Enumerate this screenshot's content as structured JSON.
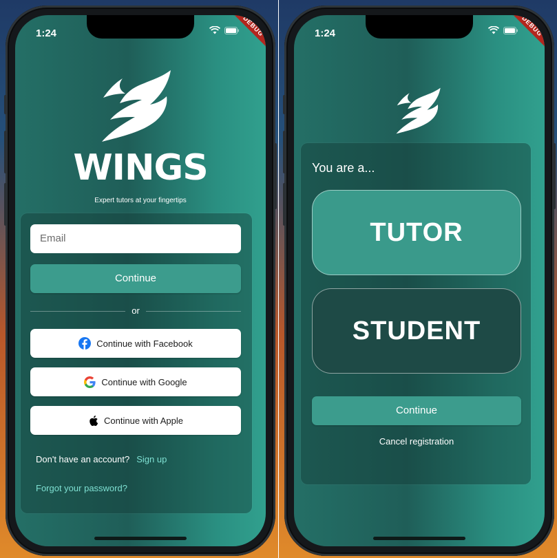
{
  "status_bar": {
    "time": "1:24",
    "debug_label": "DEBUG"
  },
  "login": {
    "brand_name": "WINGS",
    "tagline": "Expert tutors at your fingertips",
    "email_placeholder": "Email",
    "continue_label": "Continue",
    "divider_label": "or",
    "facebook_label": "Continue with Facebook",
    "google_label": "Continue with Google",
    "apple_label": "Continue with Apple",
    "no_account_text": "Don't have an account?",
    "signup_label": "Sign up",
    "forgot_label": "Forgot your password?"
  },
  "role_select": {
    "prompt": "You are a...",
    "tutor_label": "TUTOR",
    "student_label": "STUDENT",
    "continue_label": "Continue",
    "cancel_label": "Cancel registration"
  },
  "icons": {
    "logo": "wings-logo-icon",
    "wifi": "wifi-icon",
    "battery": "battery-icon",
    "facebook": "facebook-icon",
    "google": "google-icon",
    "apple": "apple-icon"
  },
  "colors": {
    "accent": "#3c9c8d",
    "link": "#7ee0d2",
    "background_dark": "#1f5e58",
    "background_light": "#31a08e",
    "student_card": "#1e4a46",
    "debug": "#b3261e"
  }
}
